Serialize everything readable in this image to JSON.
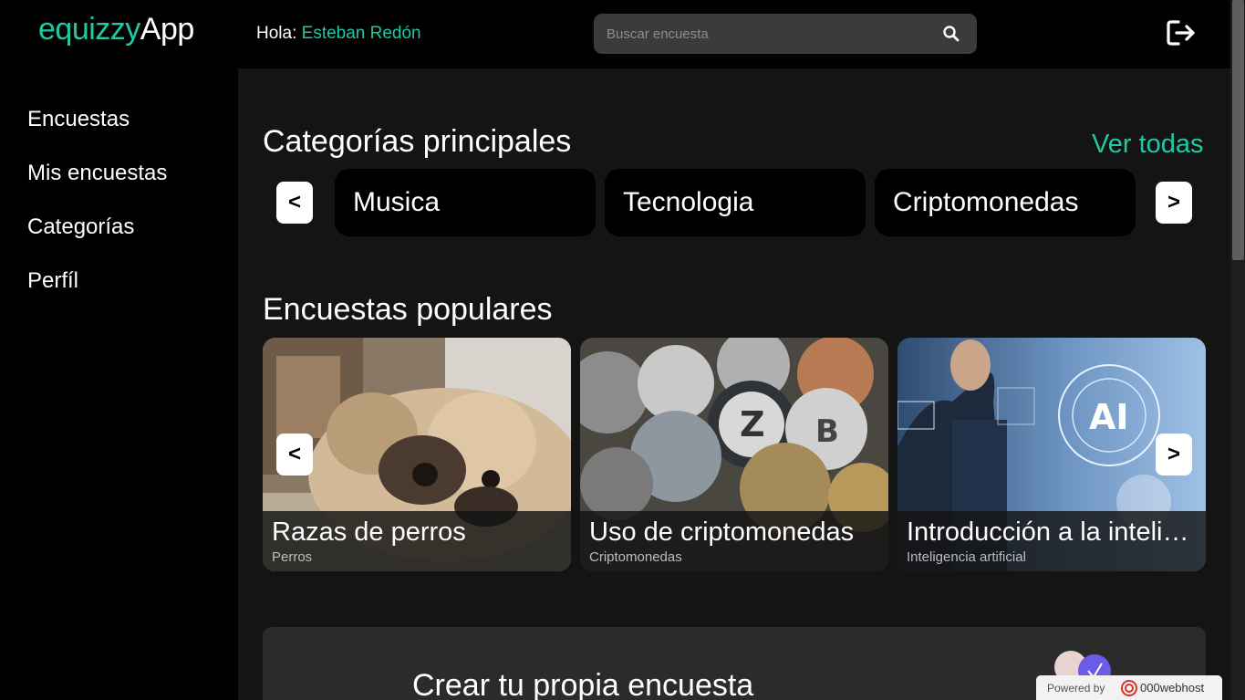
{
  "header": {
    "logo_part1": "equizzy",
    "logo_part2": "App",
    "greeting_prefix": "Hola:",
    "user_name": "Esteban Redón",
    "search_placeholder": "Buscar encuesta",
    "search_icon": "search-icon",
    "logout_icon": "logout-icon"
  },
  "sidebar": {
    "items": [
      {
        "label": "Encuestas"
      },
      {
        "label": "Mis encuestas"
      },
      {
        "label": "Categorías"
      },
      {
        "label": "Perfíl"
      }
    ]
  },
  "categories": {
    "title": "Categorías principales",
    "see_all": "Ver todas",
    "prev": "<",
    "next": ">",
    "items": [
      "Musica",
      "Tecnologia",
      "Criptomonedas"
    ]
  },
  "popular": {
    "title": "Encuestas populares",
    "prev": "<",
    "next": ">",
    "items": [
      {
        "title": "Razas de perros",
        "category": "Perros"
      },
      {
        "title": "Uso de criptomonedas",
        "category": "Criptomonedas"
      },
      {
        "title": "Introducción a la inteligencia artificial",
        "category": "Inteligencia artificial"
      }
    ]
  },
  "create": {
    "title": "Crear tu propia encuesta"
  },
  "hosting_badge": {
    "powered_by": "Powered by",
    "host": "000webhost"
  },
  "colors": {
    "accent": "#1fc9a2",
    "background": "#000000",
    "main_background": "#141414",
    "search_background": "#3b3b3b"
  }
}
